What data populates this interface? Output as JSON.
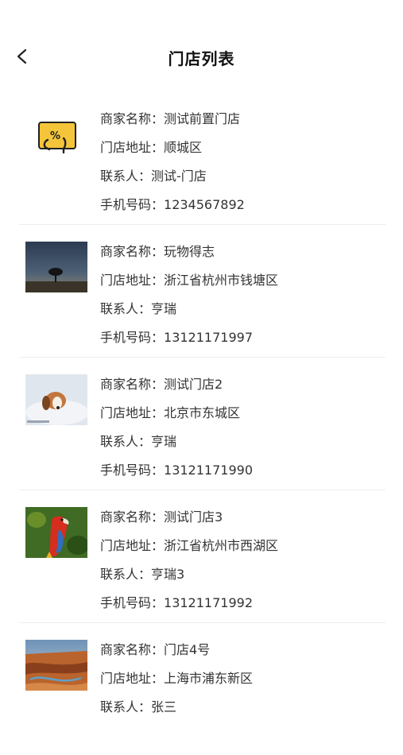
{
  "header": {
    "title": "门店列表",
    "back_icon": "chevron-left-icon"
  },
  "labels": {
    "name": "商家名称：",
    "address": "门店地址：",
    "contact": "联系人：",
    "phone": "手机号码："
  },
  "stores": [
    {
      "name": "测试前置门店",
      "address": "顺城区",
      "contact": "测试-门店",
      "phone": "1234567892",
      "image": "discount-tag-icon"
    },
    {
      "name": "玩物得志",
      "address": "浙江省杭州市钱塘区",
      "contact": "亨瑞",
      "phone": "13121171997",
      "image": "tree-night-sky-photo"
    },
    {
      "name": "测试门店2",
      "address": "北京市东城区",
      "contact": "亨瑞",
      "phone": "13121171990",
      "image": "puppy-blanket-photo"
    },
    {
      "name": "测试门店3",
      "address": "浙江省杭州市西湖区",
      "contact": "亨瑞3",
      "phone": "13121171992",
      "image": "parrot-photo"
    },
    {
      "name": "门店4号",
      "address": "上海市浦东新区",
      "contact": "张三",
      "image": "canyon-landscape-photo"
    }
  ]
}
